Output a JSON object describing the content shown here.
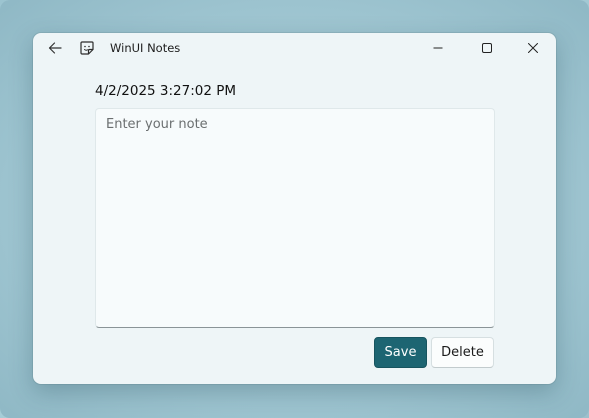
{
  "window": {
    "title": "WinUI Notes"
  },
  "note": {
    "timestamp": "4/2/2025 3:27:02 PM",
    "placeholder": "Enter your note",
    "value": ""
  },
  "actions": {
    "save_label": "Save",
    "delete_label": "Delete"
  },
  "icons": {
    "back": "arrow-left-icon",
    "app": "sticky-note-icon",
    "minimize": "minimize-icon",
    "maximize": "maximize-icon",
    "close": "close-icon"
  },
  "colors": {
    "accent": "#1d6572",
    "window_bg": "#eef5f7"
  }
}
